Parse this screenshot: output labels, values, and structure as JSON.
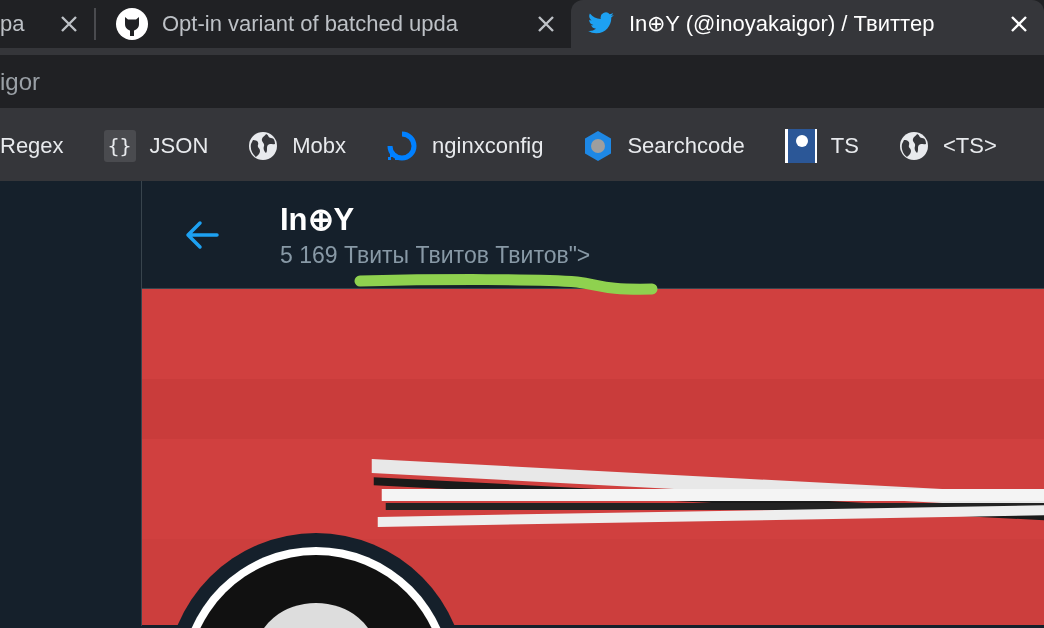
{
  "tabs": [
    {
      "title": "pa",
      "selected": false,
      "kind": "plain"
    },
    {
      "title": "Opt-in variant of batched upda",
      "selected": false,
      "kind": "cat"
    },
    {
      "title": "In⊕Y (@inoyakaigor) / Твиттер",
      "selected": true,
      "kind": "bird"
    }
  ],
  "address_bar": {
    "value": "igor"
  },
  "bookmarks": [
    {
      "label": "Regex",
      "kind": "none"
    },
    {
      "label": "JSON",
      "kind": "braces",
      "icon": "{}"
    },
    {
      "label": "Mobx",
      "kind": "globe"
    },
    {
      "label": "nginxconfig",
      "kind": "ring"
    },
    {
      "label": "Searchcode",
      "kind": "hexagon"
    },
    {
      "label": "TS",
      "kind": "book"
    },
    {
      "label": "<TS>",
      "kind": "globe"
    }
  ],
  "profile_header": {
    "name": "In⊕Y",
    "tweet_count": "5 169 Твиты Твитов Твитов\">"
  },
  "annotation": {
    "kind": "underline"
  }
}
